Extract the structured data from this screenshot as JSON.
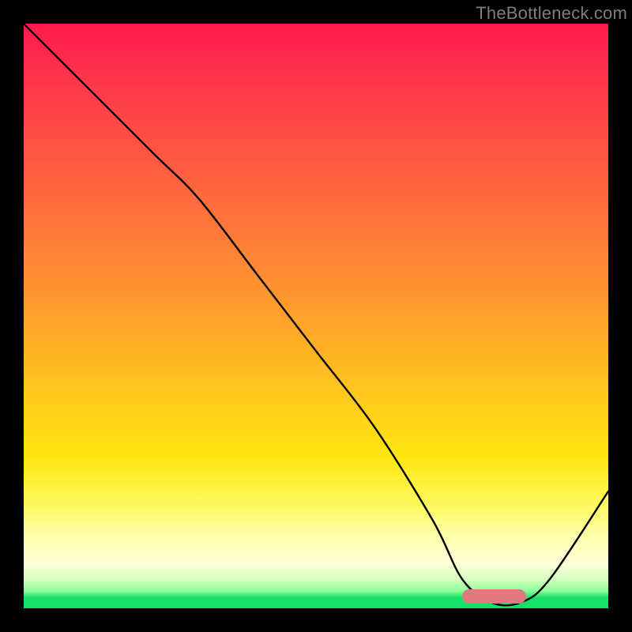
{
  "watermark": "TheBottleneck.com",
  "chart_data": {
    "type": "line",
    "title": "",
    "xlabel": "",
    "ylabel": "",
    "xlim": [
      0,
      100
    ],
    "ylim": [
      0,
      100
    ],
    "grid": false,
    "legend": false,
    "background_gradient": {
      "stops": [
        {
          "pos": 0.0,
          "color": "#ff1a4d"
        },
        {
          "pos": 0.3,
          "color": "#ff6a3e"
        },
        {
          "pos": 0.62,
          "color": "#ffc41e"
        },
        {
          "pos": 0.82,
          "color": "#fff85a"
        },
        {
          "pos": 0.92,
          "color": "#ffffd8"
        },
        {
          "pos": 0.97,
          "color": "#8fff9a"
        },
        {
          "pos": 1.0,
          "color": "#16e06a"
        }
      ]
    },
    "series": [
      {
        "name": "bottleneck-curve",
        "color": "#000000",
        "x": [
          0,
          10,
          22,
          30,
          40,
          50,
          60,
          70,
          75,
          80,
          85,
          90,
          100
        ],
        "y": [
          100,
          90,
          78,
          70,
          57,
          44,
          31,
          15,
          5,
          1,
          1,
          5,
          20
        ]
      }
    ],
    "annotations": [
      {
        "name": "optimal-range-marker",
        "shape": "rounded-bar",
        "color": "#e07a7f",
        "x_range": [
          75,
          86
        ],
        "y": 2,
        "height": 2.4
      }
    ]
  }
}
